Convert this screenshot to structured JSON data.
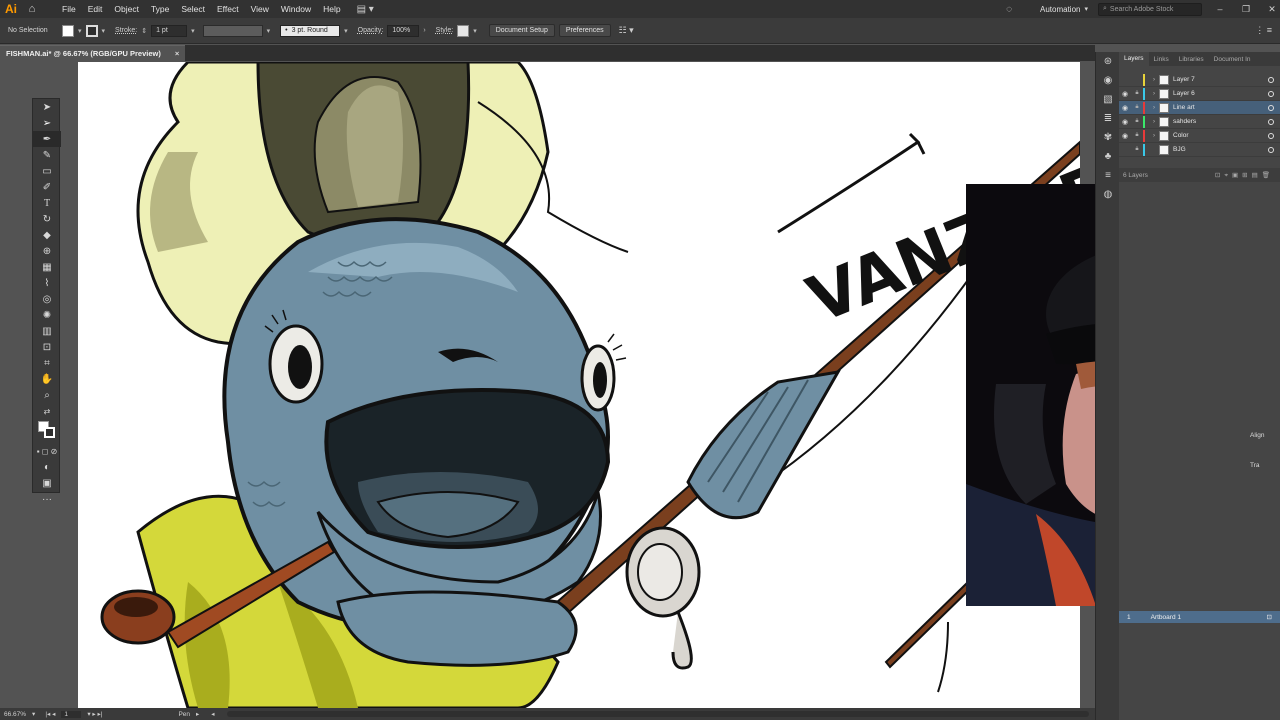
{
  "app": {
    "logo": "Ai",
    "menu": [
      "File",
      "Edit",
      "Object",
      "Type",
      "Select",
      "Effect",
      "View",
      "Window",
      "Help"
    ],
    "workspace": "Automation",
    "search_placeholder": "Search Adobe Stock"
  },
  "control_bar": {
    "selection": "No Selection",
    "stroke_label": "Stroke:",
    "stroke_value": "1 pt",
    "brush": "3 pt. Round",
    "opacity_label": "Opacity:",
    "opacity_value": "100%",
    "style_label": "Style:",
    "document_setup": "Document Setup",
    "preferences": "Preferences"
  },
  "document": {
    "tab_title": "FISHMAN.ai* @ 66.67% (RGB/GPU Preview)",
    "close": "×"
  },
  "status_bar": {
    "zoom": "66.67%",
    "artboard": "1",
    "tool": "Pen"
  },
  "panels": {
    "tabs": [
      "Layers",
      "Links",
      "Libraries",
      "Document In"
    ],
    "layers": [
      {
        "name": "Layer 7",
        "color": "#e8d33a",
        "visible": false,
        "selected": false
      },
      {
        "name": "Layer 6",
        "color": "#3ac8e8",
        "visible": true,
        "selected": false
      },
      {
        "name": "Line art",
        "color": "#e83a3a",
        "visible": true,
        "selected": true
      },
      {
        "name": "sahders",
        "color": "#3ae86a",
        "visible": true,
        "selected": false
      },
      {
        "name": "Color",
        "color": "#e83a3a",
        "visible": true,
        "selected": false
      },
      {
        "name": "BJG",
        "color": "#3ac8e8",
        "visible": false,
        "selected": false
      }
    ],
    "layer_count": "6 Layers",
    "artboards": [
      {
        "index": "1",
        "name": "Artboard 1"
      }
    ],
    "side_labels": [
      "Align",
      "Tra"
    ]
  },
  "artwork": {
    "signature": "VANZIDER"
  },
  "colors": {
    "ui_dark": "#323232",
    "ui_panel": "#454545",
    "selection_blue": "#46607a",
    "fish_blue": "#6f8fa3",
    "fish_yellow": "#d4d83a",
    "hat_cream": "#eef0b6",
    "hat_olive": "#8c8a66",
    "rod_brown": "#7a3f1e"
  }
}
